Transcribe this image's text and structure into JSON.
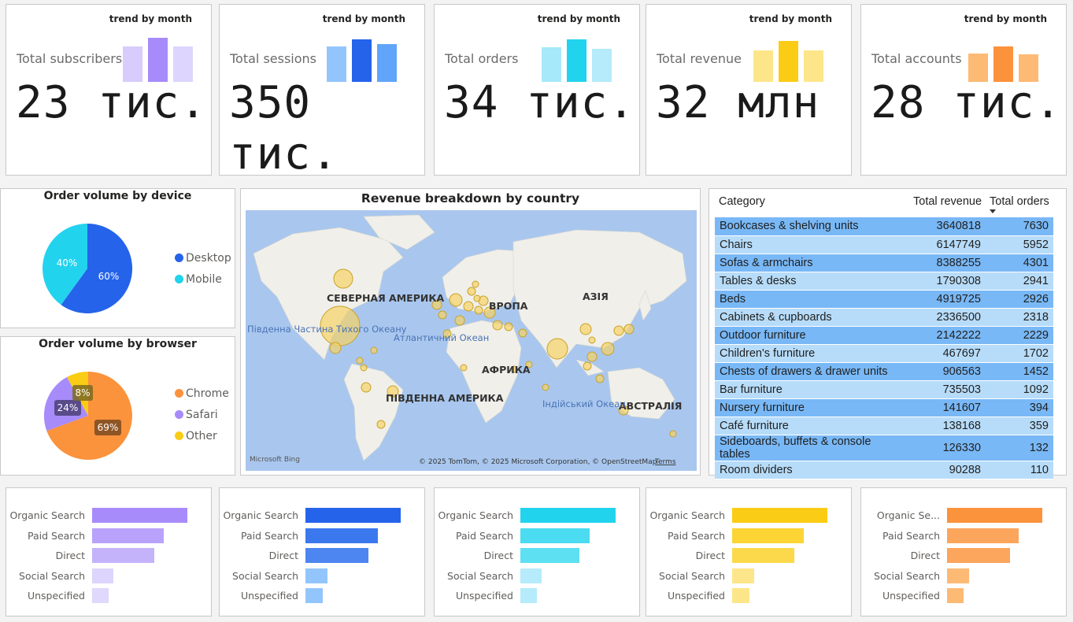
{
  "kpis": [
    {
      "label": "Total subscribers",
      "value": "23 тис.",
      "trend": "trend by month",
      "colors": [
        "#d7ccfc",
        "#a78bfa",
        "#ddd5fd"
      ]
    },
    {
      "label": "Total sessions",
      "value": "350 тис.",
      "trend": "trend by month",
      "colors": [
        "#93c5fd",
        "#2563eb",
        "#60a5fa"
      ]
    },
    {
      "label": "Total orders",
      "value": "34 тис.",
      "trend": "trend by month",
      "colors": [
        "#a5e9fa",
        "#22d3ee",
        "#b5ebfb"
      ]
    },
    {
      "label": "Total revenue",
      "value": "32 млн",
      "trend": "trend by month",
      "colors": [
        "#fde68a",
        "#facc15",
        "#fde68a"
      ]
    },
    {
      "label": "Total accounts",
      "value": "28 тис.",
      "trend": "trend by month",
      "colors": [
        "#fdba74",
        "#fb923c",
        "#fdba74"
      ]
    }
  ],
  "device_chart": {
    "title": "Order volume by device",
    "legend": [
      "Desktop",
      "Mobile"
    ],
    "colors": [
      "#2563eb",
      "#22d3ee"
    ],
    "slice_labels": [
      "60%",
      "40%"
    ]
  },
  "browser_chart": {
    "title": "Order volume by browser",
    "legend": [
      "Chrome",
      "Safari",
      "Other"
    ],
    "colors": [
      "#fb923c",
      "#a78bfa",
      "#facc15"
    ],
    "slice_labels": [
      "69%",
      "24%",
      "8%"
    ]
  },
  "map": {
    "title": "Revenue breakdown by country",
    "labels": {
      "north_america": "СЕВЕРНАЯ АМЕРИКА",
      "europe": "ВРОПА",
      "asia": "АЗІЯ",
      "africa": "АФРИКА",
      "south_america": "ПІВДЕННА АМЕРИКА",
      "australia": "АВСТРАЛІЯ",
      "pacific": "Південна Частина Тихого Океану",
      "atlantic": "Атлантичний Океан",
      "indian": "Індійський Океан"
    },
    "copyright": "© 2025 TomTom, © 2025 Microsoft Corporation, © OpenStreetMap",
    "terms": "Terms",
    "provider": "Microsoft Bing"
  },
  "table": {
    "headers": [
      "Category",
      "Total revenue",
      "Total orders"
    ],
    "rows": [
      [
        "Bookcases & shelving units",
        "3640818",
        "7630"
      ],
      [
        "Chairs",
        "6147749",
        "5952"
      ],
      [
        "Sofas & armchairs",
        "8388255",
        "4301"
      ],
      [
        "Tables & desks",
        "1790308",
        "2941"
      ],
      [
        "Beds",
        "4919725",
        "2926"
      ],
      [
        "Cabinets & cupboards",
        "2336500",
        "2318"
      ],
      [
        "Outdoor furniture",
        "2142222",
        "2229"
      ],
      [
        "Children's furniture",
        "467697",
        "1702"
      ],
      [
        "Chests of drawers & drawer units",
        "906563",
        "1452"
      ],
      [
        "Bar furniture",
        "735503",
        "1092"
      ],
      [
        "Nursery furniture",
        "141607",
        "394"
      ],
      [
        "Café furniture",
        "138168",
        "359"
      ],
      [
        "Sideboards, buffets & console tables",
        "126330",
        "132"
      ],
      [
        "Room dividers",
        "90288",
        "110"
      ]
    ],
    "row_colors": [
      "#79b8f6",
      "#b7dcf9"
    ]
  },
  "channel_charts": [
    {
      "labels": [
        "Organic Search",
        "Paid Search",
        "Direct",
        "Social Search",
        "Unspecified"
      ],
      "values": [
        1.0,
        0.75,
        0.65,
        0.22,
        0.17
      ],
      "colors": [
        "#a78bfa",
        "#b9a2fb",
        "#c4b3fb",
        "#ddd5fd",
        "#e0d8fd"
      ]
    },
    {
      "labels": [
        "Organic Search",
        "Paid Search",
        "Direct",
        "Social Search",
        "Unspecified"
      ],
      "values": [
        1.0,
        0.76,
        0.66,
        0.23,
        0.18
      ],
      "colors": [
        "#2563eb",
        "#3b78ee",
        "#4d86f0",
        "#93c5fd",
        "#93c5fd"
      ]
    },
    {
      "labels": [
        "Organic Search",
        "Paid Search",
        "Direct",
        "Social Search",
        "Unspecified"
      ],
      "values": [
        1.0,
        0.73,
        0.62,
        0.22,
        0.17
      ],
      "colors": [
        "#22d3ee",
        "#4bdcf1",
        "#5de0f2",
        "#b5ebfb",
        "#b5ebfb"
      ]
    },
    {
      "labels": [
        "Organic Search",
        "Paid Search",
        "Direct",
        "Social Search",
        "Unspecified"
      ],
      "values": [
        1.0,
        0.75,
        0.65,
        0.23,
        0.18
      ],
      "colors": [
        "#facc15",
        "#fcd535",
        "#fcd94a",
        "#fde68a",
        "#fde68a"
      ]
    },
    {
      "labels": [
        "Organic Se...",
        "Paid Search",
        "Direct",
        "Social Search",
        "Unspecified"
      ],
      "values": [
        1.0,
        0.75,
        0.66,
        0.23,
        0.17
      ],
      "colors": [
        "#fb923c",
        "#fca55c",
        "#fca55c",
        "#fdba74",
        "#fdba74"
      ]
    }
  ]
}
